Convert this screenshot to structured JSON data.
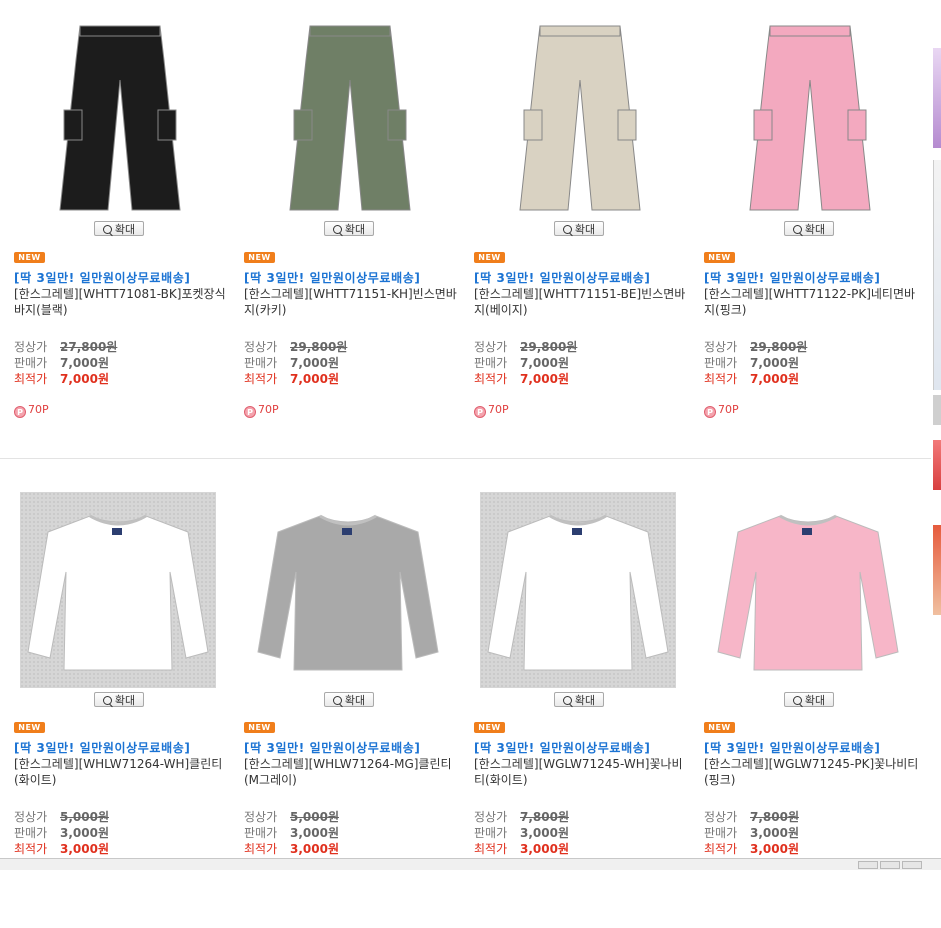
{
  "zoom_label": "확대",
  "new_badge": "NEW",
  "promo": "[딱 3일만! 일만원이상무료배송]",
  "labels": {
    "regular": "정상가",
    "sale": "판매가",
    "best": "최적가"
  },
  "products": [
    {
      "name": "[한스그레텔][WHTT71081-BK]포켓장식바지(블랙)",
      "regular_price": "27,800원",
      "sale_price": "7,000원",
      "best_price": "7,000원",
      "points": "70P",
      "color": "#1c1c1c",
      "type": "pants"
    },
    {
      "name": "[한스그레텔][WHTT71151-KH]빈스면바지(카키)",
      "regular_price": "29,800원",
      "sale_price": "7,000원",
      "best_price": "7,000원",
      "points": "70P",
      "color": "#6f7f66",
      "type": "pants"
    },
    {
      "name": "[한스그레텔][WHTT71151-BE]빈스면바지(베이지)",
      "regular_price": "29,800원",
      "sale_price": "7,000원",
      "best_price": "7,000원",
      "points": "70P",
      "color": "#d9d2c2",
      "type": "pants"
    },
    {
      "name": "[한스그레텔][WHTT71122-PK]네티면바지(핑크)",
      "regular_price": "29,800원",
      "sale_price": "7,000원",
      "best_price": "7,000원",
      "points": "70P",
      "color": "#f3a9bf",
      "type": "pants"
    },
    {
      "name": "[한스그레텔][WHLW71264-WH]클린티(화이트)",
      "regular_price": "5,000원",
      "sale_price": "3,000원",
      "best_price": "3,000원",
      "points": "",
      "color": "#ffffff",
      "type": "tee"
    },
    {
      "name": "[한스그레텔][WHLW71264-MG]클린티(M그레이)",
      "regular_price": "5,000원",
      "sale_price": "3,000원",
      "best_price": "3,000원",
      "points": "",
      "color": "#a9a9a9",
      "type": "tee"
    },
    {
      "name": "[한스그레텔][WGLW71245-WH]꽃나비티(화이트)",
      "regular_price": "7,800원",
      "sale_price": "3,000원",
      "best_price": "3,000원",
      "points": "",
      "color": "#ffffff",
      "type": "tee"
    },
    {
      "name": "[한스그레텔][WGLW71245-PK]꽃나비티(핑크)",
      "regular_price": "7,800원",
      "sale_price": "3,000원",
      "best_price": "3,000원",
      "points": "",
      "color": "#f7b6c8",
      "type": "tee"
    }
  ]
}
